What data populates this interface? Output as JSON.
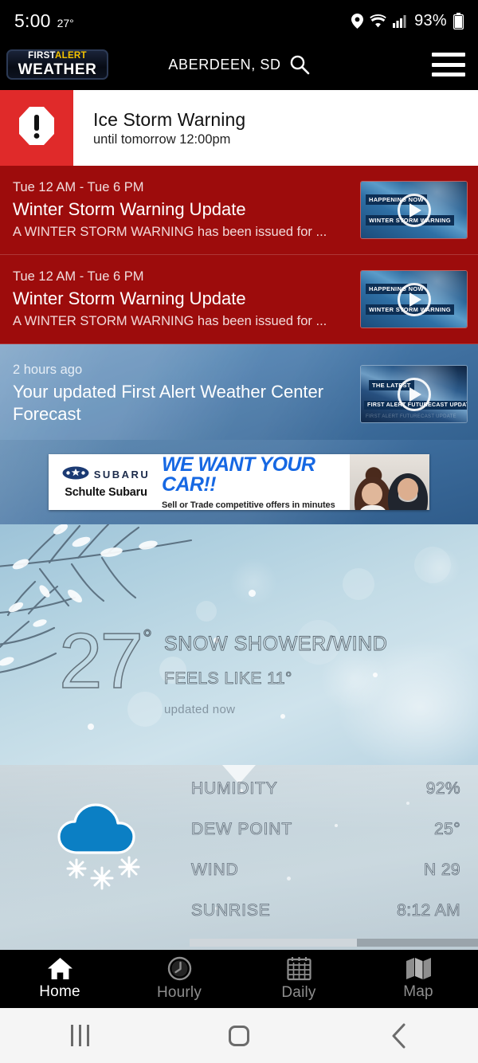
{
  "status_bar": {
    "time": "5:00",
    "temp": "27°",
    "battery": "93%",
    "icons": [
      "location-icon",
      "wifi-icon",
      "cellular-signal-icon",
      "battery-icon"
    ]
  },
  "app_header": {
    "logo_top": "FIRST",
    "logo_top_accent": "ALERT",
    "logo_bottom": "WEATHER",
    "location": "ABERDEEN, SD",
    "search_icon": "search-icon",
    "menu_icon": "hamburger-menu-icon"
  },
  "alert_banner": {
    "icon": "exclamation-octagon-icon",
    "title": "Ice Storm Warning",
    "subtitle": "until tomorrow 12:00pm",
    "accent_color": "#e02a2a"
  },
  "cards": [
    {
      "style": "red",
      "time": "Tue 12 AM - Tue 6 PM",
      "headline": "Winter Storm Warning Update",
      "description": "A WINTER STORM WARNING has been issued for ...",
      "thumb_label_top": "HAPPENING NOW",
      "thumb_label_bottom": "WINTER STORM WARNING",
      "thumb_faint": "",
      "play_icon": "play-button-icon"
    },
    {
      "style": "red",
      "time": "Tue 12 AM - Tue 6 PM",
      "headline": "Winter Storm Warning Update",
      "description": "A WINTER STORM WARNING has been issued for ...",
      "thumb_label_top": "HAPPENING NOW",
      "thumb_label_bottom": "WINTER STORM WARNING",
      "thumb_faint": "",
      "play_icon": "play-button-icon"
    },
    {
      "style": "blue",
      "time": "2 hours ago",
      "headline": "Your updated First Alert Weather Center Forecast",
      "description": "",
      "thumb_label_top": "THE LATEST",
      "thumb_label_bottom": "FIRST ALERT FUTURECAST UPDATE",
      "thumb_faint": "FIRST ALERT FUTURECAST UPDATE",
      "play_icon": "play-button-icon"
    }
  ],
  "ad": {
    "brand": "SUBARU",
    "dealer": "Schulte Subaru",
    "headline": "WE WANT YOUR CAR!!",
    "tagline": "Sell or Trade competitive offers in minutes",
    "headline_color": "#1668e3"
  },
  "current": {
    "temperature": "27",
    "degree": "°",
    "condition": "SNOW SHOWER/WIND",
    "feels_like": "FEELS LIKE 11°",
    "updated": "updated now",
    "weather_icon": "cloud-with-snow-icon"
  },
  "details": [
    {
      "key": "HUMIDITY",
      "value": "92%"
    },
    {
      "key": "DEW POINT",
      "value": "25°"
    },
    {
      "key": "WIND",
      "value": "N 29"
    },
    {
      "key": "SUNRISE",
      "value": "8:12 AM"
    }
  ],
  "tabs": [
    {
      "label": "Home",
      "icon": "home-icon",
      "active": true
    },
    {
      "label": "Hourly",
      "icon": "clock-icon",
      "active": false
    },
    {
      "label": "Daily",
      "icon": "calendar-icon",
      "active": false
    },
    {
      "label": "Map",
      "icon": "map-icon",
      "active": false
    }
  ],
  "android_nav": {
    "recents": "recents-icon",
    "home": "home-square-icon",
    "back": "back-chevron-icon"
  }
}
